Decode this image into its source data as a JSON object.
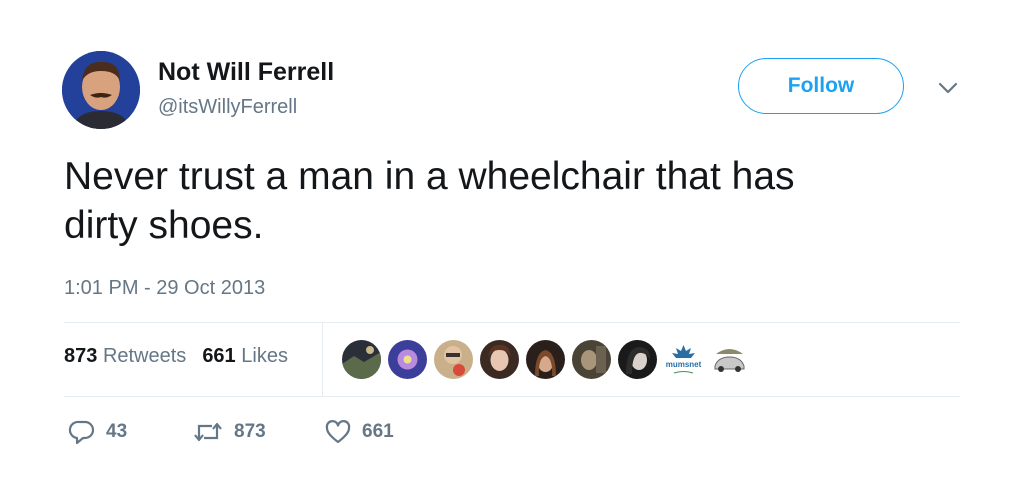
{
  "user": {
    "display_name": "Not Will Ferrell",
    "handle": "@itsWillyFerrell"
  },
  "follow_label": "Follow",
  "tweet": {
    "text_line1": "Never trust a man in a wheelchair that has",
    "text_line2": "dirty shoes.",
    "timestamp": "1:01 PM - 29 Oct 2013"
  },
  "stats": {
    "retweets_count": "873",
    "retweets_label": "Retweets",
    "likes_count": "661",
    "likes_label": "Likes"
  },
  "likers_badge_text": "mumsnet",
  "actions": {
    "reply_count": "43",
    "retweet_count": "873",
    "like_count": "661"
  },
  "colors": {
    "accent": "#1da1f2",
    "secondary_text": "#657786",
    "primary_text": "#14171a"
  }
}
